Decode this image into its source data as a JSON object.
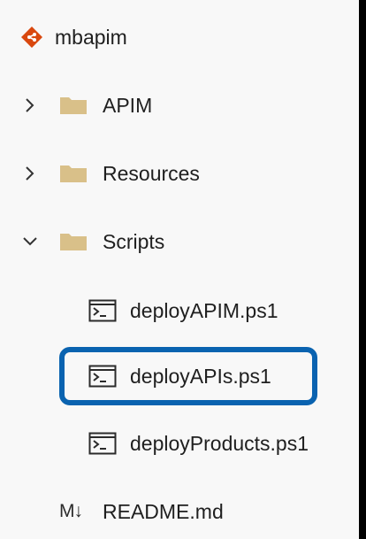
{
  "repo": {
    "name": "mbapim",
    "icon": "git-diamond-icon",
    "icon_color": "#d9480f"
  },
  "tree": {
    "folders": [
      {
        "label": "APIM",
        "state": "collapsed"
      },
      {
        "label": "Resources",
        "state": "collapsed"
      },
      {
        "label": "Scripts",
        "state": "expanded"
      }
    ],
    "script_files": [
      {
        "label": "deployAPIM.ps1"
      },
      {
        "label": "deployAPIs.ps1",
        "highlighted": true
      },
      {
        "label": "deployProducts.ps1"
      }
    ],
    "readme": {
      "icon_text": "M↓",
      "label": "README.md"
    }
  },
  "colors": {
    "highlight": "#0a63b0",
    "folder": "#d9c089",
    "background": "#f8f8f8"
  }
}
